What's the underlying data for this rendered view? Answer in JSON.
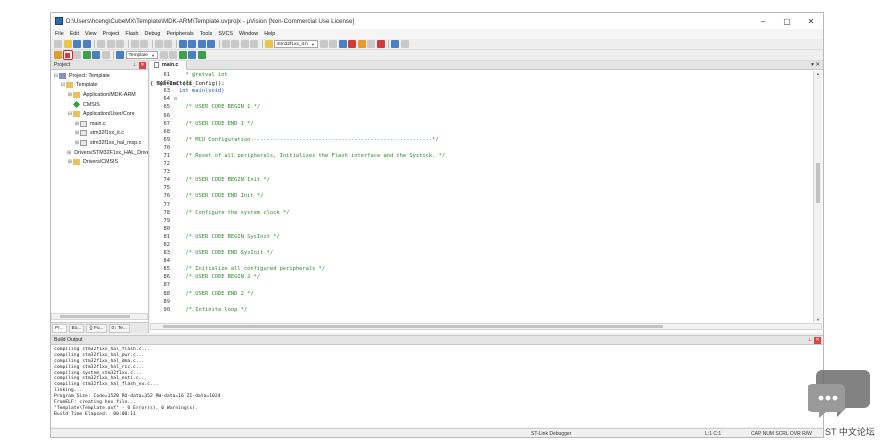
{
  "window": {
    "title": "D:\\Users\\hceng\\CubeMX\\Template\\MDK-ARM\\Template.uvprojx - µVision  [Non-Commercial Use License]",
    "minimize": "–",
    "maximize": "▢",
    "close": "✕"
  },
  "menu": [
    "File",
    "Edit",
    "View",
    "Project",
    "Flash",
    "Debug",
    "Peripherals",
    "Tools",
    "SVCS",
    "Window",
    "Help"
  ],
  "toolbar": {
    "device_combo": "stm32f1xx_it.h",
    "target_combo": "Template"
  },
  "project_pane": {
    "title": "Project",
    "tree": [
      {
        "label": "Project: Template",
        "icon": "proj",
        "indent": 0,
        "toggle": "⊟"
      },
      {
        "label": "Template",
        "icon": "folder",
        "indent": 1,
        "toggle": "⊟"
      },
      {
        "label": "Application/MDK-ARM",
        "icon": "folder",
        "indent": 2,
        "toggle": "⊞"
      },
      {
        "label": "CMSIS",
        "icon": "diamond",
        "indent": 2,
        "toggle": ""
      },
      {
        "label": "Application/User/Core",
        "icon": "folder",
        "indent": 2,
        "toggle": "⊟"
      },
      {
        "label": "main.c",
        "icon": "file",
        "indent": 3,
        "toggle": "⊞"
      },
      {
        "label": "stm32f1xx_it.c",
        "icon": "file",
        "indent": 3,
        "toggle": "⊞"
      },
      {
        "label": "stm32f1xx_hal_msp.c",
        "icon": "file",
        "indent": 3,
        "toggle": "⊞"
      },
      {
        "label": "Drivers/STM32F1xx_HAL_Driver",
        "icon": "folder",
        "indent": 2,
        "toggle": "⊞"
      },
      {
        "label": "Drivers/CMSIS",
        "icon": "folder",
        "indent": 2,
        "toggle": "⊞"
      }
    ],
    "tabs": [
      "Pr...",
      "Bo...",
      "{} Fu...",
      "0↓ Te..."
    ]
  },
  "editor": {
    "tab_label": "main.c",
    "lines": [
      {
        "n": "61",
        "fold": "",
        "text": "  * @retval int",
        "type": "comment"
      },
      {
        "n": "62",
        "fold": "",
        "text": "  */",
        "type": "comment"
      },
      {
        "n": "63",
        "fold": "",
        "text": "int main(void)",
        "type": "kw"
      },
      {
        "n": "64",
        "fold": "⊟",
        "text": "{",
        "type": "code"
      },
      {
        "n": "65",
        "fold": "",
        "text": "  /* USER CODE BEGIN 1 */",
        "type": "comment"
      },
      {
        "n": "66",
        "fold": "",
        "text": "",
        "type": "code"
      },
      {
        "n": "67",
        "fold": "",
        "text": "  /* USER CODE END 1 */",
        "type": "comment"
      },
      {
        "n": "68",
        "fold": "",
        "text": "",
        "type": "code"
      },
      {
        "n": "69",
        "fold": "",
        "text": "  /* MCU Configuration--------------------------------------------------------*/",
        "type": "comment"
      },
      {
        "n": "70",
        "fold": "",
        "text": "",
        "type": "code"
      },
      {
        "n": "71",
        "fold": "",
        "text": "  /* Reset of all peripherals, Initializes the Flash interface and the Systick. */",
        "type": "comment"
      },
      {
        "n": "72",
        "fold": "",
        "text": "  HAL_Init();",
        "type": "code"
      },
      {
        "n": "73",
        "fold": "",
        "text": "",
        "type": "code"
      },
      {
        "n": "74",
        "fold": "",
        "text": "  /* USER CODE BEGIN Init */",
        "type": "comment"
      },
      {
        "n": "75",
        "fold": "",
        "text": "",
        "type": "code"
      },
      {
        "n": "76",
        "fold": "",
        "text": "  /* USER CODE END Init */",
        "type": "comment"
      },
      {
        "n": "77",
        "fold": "",
        "text": "",
        "type": "code"
      },
      {
        "n": "78",
        "fold": "",
        "text": "  /* Configure the system clock */",
        "type": "comment"
      },
      {
        "n": "79",
        "fold": "",
        "text": "  SystemClock_Config();",
        "type": "code"
      },
      {
        "n": "80",
        "fold": "",
        "text": "",
        "type": "code"
      },
      {
        "n": "81",
        "fold": "",
        "text": "  /* USER CODE BEGIN SysInit */",
        "type": "comment"
      },
      {
        "n": "82",
        "fold": "",
        "text": "",
        "type": "code"
      },
      {
        "n": "83",
        "fold": "",
        "text": "  /* USER CODE END SysInit */",
        "type": "comment"
      },
      {
        "n": "84",
        "fold": "",
        "text": "",
        "type": "code"
      },
      {
        "n": "85",
        "fold": "",
        "text": "  /* Initialize all configured peripherals */",
        "type": "comment"
      },
      {
        "n": "86",
        "fold": "",
        "text": "  /* USER CODE BEGIN 2 */",
        "type": "comment"
      },
      {
        "n": "87",
        "fold": "",
        "text": "",
        "type": "code"
      },
      {
        "n": "88",
        "fold": "",
        "text": "  /* USER CODE END 2 */",
        "type": "comment"
      },
      {
        "n": "89",
        "fold": "",
        "text": "",
        "type": "code"
      },
      {
        "n": "90",
        "fold": "",
        "text": "  /* Infinite loop */",
        "type": "comment"
      }
    ]
  },
  "build_output": {
    "title": "Build Output",
    "lines": [
      "compiling stm32f1xx_hal_flash.c...",
      "compiling stm32f1xx_hal_pwr.c...",
      "compiling stm32f1xx_hal_dma.c...",
      "compiling stm32f1xx_hal_rcc.c...",
      "compiling system_stm32f1xx.c...",
      "compiling stm32f1xx_hal_exti.c...",
      "compiling stm32f1xx_hal_flash_ex.c...",
      "linking...",
      "Program Size: Code=1520 RO-data=352 RW-data=16 ZI-data=1024",
      "FromELF: creating hex file...",
      "\"Template\\Template.axf\" - 0 Error(s), 0 Warning(s).",
      "Build Time Elapsed:  00:00:11"
    ]
  },
  "statusbar": {
    "debugger": "ST-Link Debugger",
    "position": "L:1 C:1",
    "indicators": "CAP  NUM  SCRL  OVR  R/W"
  },
  "watermark": {
    "text": "ST 中文论坛"
  }
}
